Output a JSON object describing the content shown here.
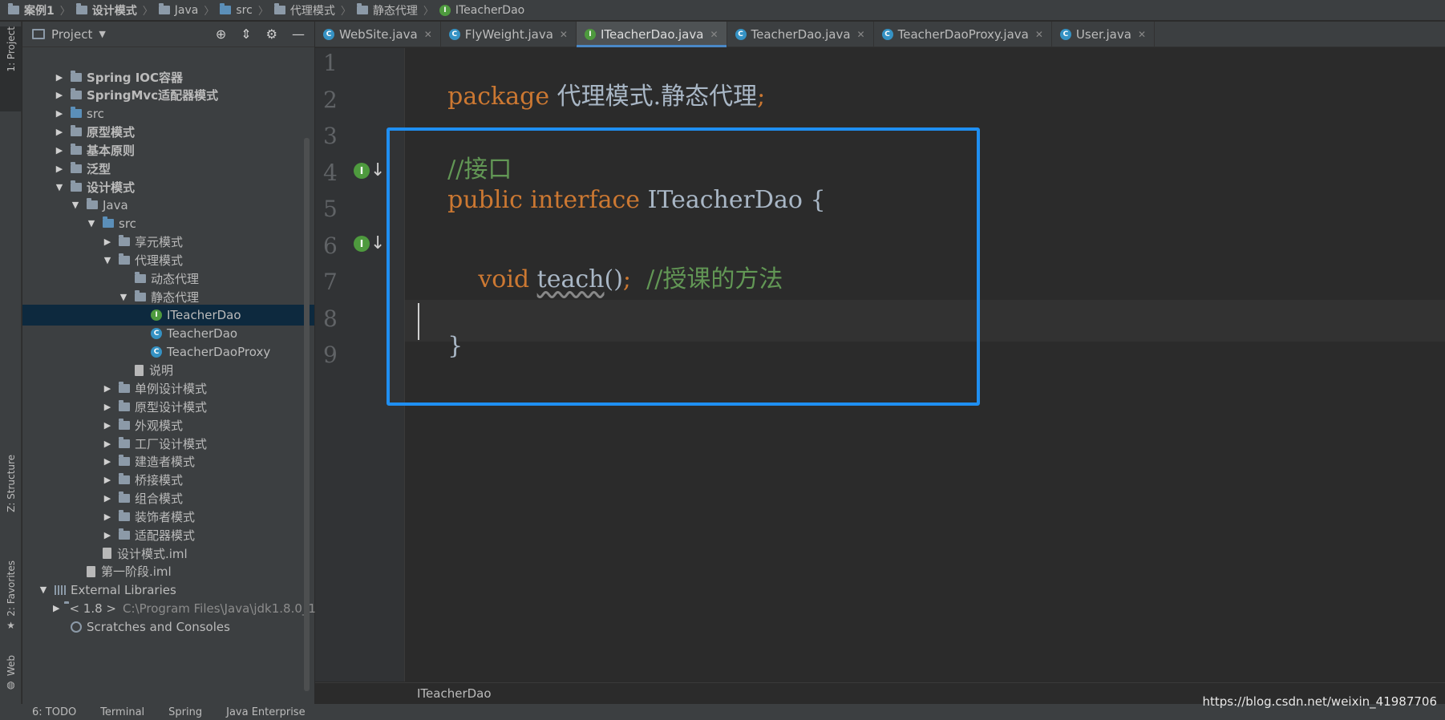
{
  "breadcrumb": [
    "案例1",
    "设计模式",
    "Java",
    "src",
    "代理模式",
    "静态代理",
    "ITeacherDao"
  ],
  "left_strip": {
    "project_tab": "1: Project",
    "structure_tab": "Z: Structure",
    "favorites_tab": "2: Favorites",
    "web_tab": "Web"
  },
  "project_panel": {
    "title": "Project",
    "tree": [
      {
        "label": "Spring IOC容器",
        "level": 1,
        "arrow": "▶",
        "icon": "folder",
        "bold": true
      },
      {
        "label": "SpringMvc适配器模式",
        "level": 1,
        "arrow": "▶",
        "icon": "folder",
        "bold": true
      },
      {
        "label": "src",
        "level": 1,
        "arrow": "▶",
        "icon": "folder-src",
        "bold": false
      },
      {
        "label": "原型模式",
        "level": 1,
        "arrow": "▶",
        "icon": "folder",
        "bold": true
      },
      {
        "label": "基本原则",
        "level": 1,
        "arrow": "▶",
        "icon": "folder",
        "bold": true
      },
      {
        "label": "泛型",
        "level": 1,
        "arrow": "▶",
        "icon": "folder",
        "bold": true
      },
      {
        "label": "设计模式",
        "level": 1,
        "arrow": "▼",
        "icon": "folder",
        "bold": true
      },
      {
        "label": "Java",
        "level": 2,
        "arrow": "▼",
        "icon": "folder",
        "bold": false
      },
      {
        "label": "src",
        "level": 3,
        "arrow": "▼",
        "icon": "folder-src",
        "bold": false
      },
      {
        "label": "享元模式",
        "level": 4,
        "arrow": "▶",
        "icon": "folder",
        "bold": false
      },
      {
        "label": "代理模式",
        "level": 4,
        "arrow": "▼",
        "icon": "folder",
        "bold": false
      },
      {
        "label": "动态代理",
        "level": 5,
        "arrow": "",
        "icon": "folder",
        "bold": false
      },
      {
        "label": "静态代理",
        "level": 5,
        "arrow": "▼",
        "icon": "folder",
        "bold": false
      },
      {
        "label": "ITeacherDao",
        "level": 6,
        "arrow": "",
        "icon": "interface",
        "bold": false,
        "selected": true
      },
      {
        "label": "TeacherDao",
        "level": 6,
        "arrow": "",
        "icon": "class",
        "bold": false
      },
      {
        "label": "TeacherDaoProxy",
        "level": 6,
        "arrow": "",
        "icon": "class",
        "bold": false
      },
      {
        "label": "说明",
        "level": 5,
        "arrow": "",
        "icon": "file",
        "bold": false
      },
      {
        "label": "单例设计模式",
        "level": 4,
        "arrow": "▶",
        "icon": "folder",
        "bold": false
      },
      {
        "label": "原型设计模式",
        "level": 4,
        "arrow": "▶",
        "icon": "folder",
        "bold": false
      },
      {
        "label": "外观模式",
        "level": 4,
        "arrow": "▶",
        "icon": "folder",
        "bold": false
      },
      {
        "label": "工厂设计模式",
        "level": 4,
        "arrow": "▶",
        "icon": "folder",
        "bold": false
      },
      {
        "label": "建造者模式",
        "level": 4,
        "arrow": "▶",
        "icon": "folder",
        "bold": false
      },
      {
        "label": "桥接模式",
        "level": 4,
        "arrow": "▶",
        "icon": "folder",
        "bold": false
      },
      {
        "label": "组合模式",
        "level": 4,
        "arrow": "▶",
        "icon": "folder",
        "bold": false
      },
      {
        "label": "装饰者模式",
        "level": 4,
        "arrow": "▶",
        "icon": "folder",
        "bold": false
      },
      {
        "label": "适配器模式",
        "level": 4,
        "arrow": "▶",
        "icon": "folder",
        "bold": false
      },
      {
        "label": "设计模式.iml",
        "level": 3,
        "arrow": "",
        "icon": "file",
        "bold": false
      },
      {
        "label": "第一阶段.iml",
        "level": 2,
        "arrow": "",
        "icon": "file",
        "bold": false
      },
      {
        "label": "External Libraries",
        "level": 0,
        "arrow": "▼",
        "icon": "library",
        "bold": false
      },
      {
        "label": "< 1.8 >",
        "level": 1,
        "arrow": "▶",
        "icon": "folder",
        "bold": false,
        "path": "C:\\Program Files\\Java\\jdk1.8.0_1"
      },
      {
        "label": "Scratches and Consoles",
        "level": 1,
        "arrow": "",
        "icon": "scratch",
        "bold": false
      }
    ]
  },
  "tabs": [
    {
      "label": "WebSite.java",
      "icon": "class",
      "active": false
    },
    {
      "label": "FlyWeight.java",
      "icon": "class",
      "active": false
    },
    {
      "label": "ITeacherDao.java",
      "icon": "interface",
      "active": true
    },
    {
      "label": "TeacherDao.java",
      "icon": "class",
      "active": false
    },
    {
      "label": "TeacherDaoProxy.java",
      "icon": "class",
      "active": false
    },
    {
      "label": "User.java",
      "icon": "class",
      "active": false
    }
  ],
  "editor": {
    "line_numbers": [
      "1",
      "2",
      "3",
      "4",
      "5",
      "6",
      "7",
      "8",
      "9"
    ],
    "code": {
      "l1_kw": "package",
      "l1_pkg": " 代理模式.静态代理",
      "l1_semi": ";",
      "l3_comment": "//接口",
      "l4_kw": "public interface",
      "l4_name": " ITeacherDao {",
      "l6_indent": "    ",
      "l6_kw": "void",
      "l6_fn": "teach",
      "l6_paren": "()",
      "l6_semi": ";",
      "l6_comment": "  //授课的方法",
      "l8_brace": "}"
    },
    "current_line": 7,
    "crumb": "ITeacherDao"
  },
  "bottom_bar": [
    "6: TODO",
    "Terminal",
    "Spring",
    "Java Enterprise"
  ],
  "watermark": "https://blog.csdn.net/weixin_41987706"
}
